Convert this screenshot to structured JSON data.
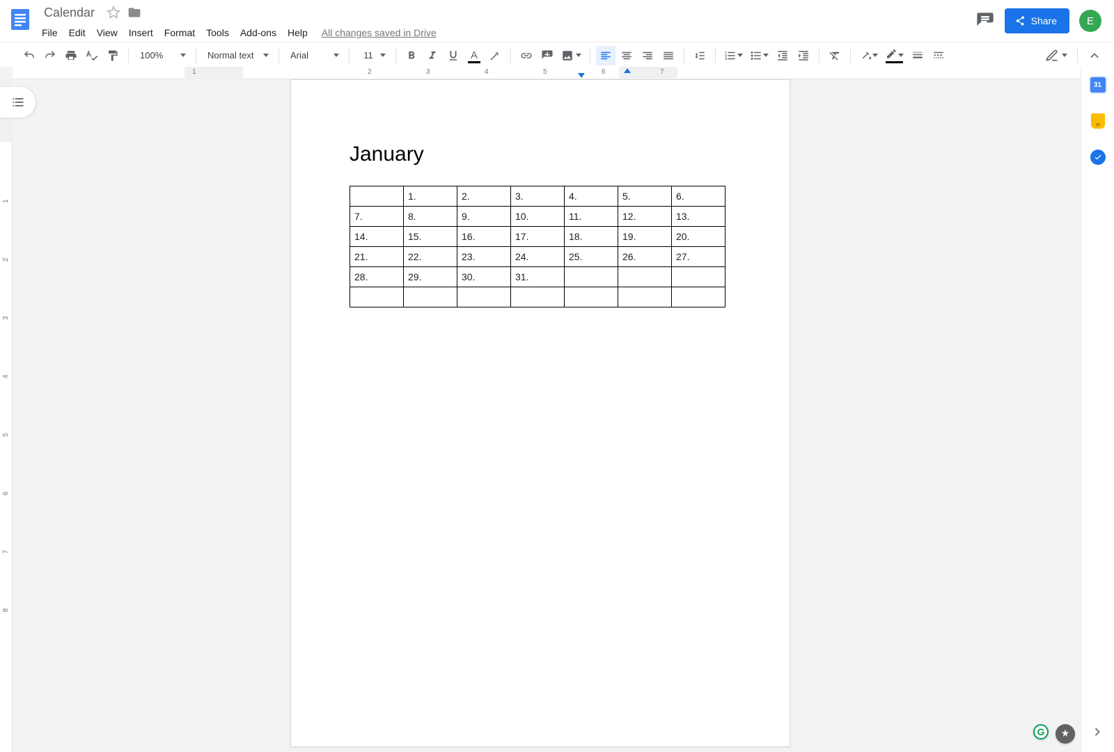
{
  "doc": {
    "title": "Calendar"
  },
  "menus": [
    "File",
    "Edit",
    "View",
    "Insert",
    "Format",
    "Tools",
    "Add-ons",
    "Help"
  ],
  "save_status": "All changes saved in Drive",
  "share_label": "Share",
  "avatar_initial": "E",
  "toolbar": {
    "zoom": "100%",
    "style": "Normal text",
    "font": "Arial",
    "size": "11"
  },
  "ruler": {
    "h_labels": [
      "1",
      "2",
      "3",
      "4",
      "5",
      "6",
      "7"
    ],
    "v_labels": [
      "1",
      "2",
      "3",
      "4",
      "5",
      "6",
      "7",
      "8"
    ]
  },
  "side_calendar_day": "31",
  "content": {
    "heading": "January",
    "rows": [
      [
        "",
        "1.",
        "2.",
        "3.",
        "4.",
        "5.",
        "6."
      ],
      [
        "7.",
        "8.",
        "9.",
        "10.",
        "11.",
        "12.",
        "13."
      ],
      [
        "14.",
        "15.",
        "16.",
        "17.",
        "18.",
        "19.",
        "20."
      ],
      [
        "21.",
        "22.",
        "23.",
        "24.",
        "25.",
        "26.",
        "27."
      ],
      [
        "28.",
        "29.",
        "30.",
        "31.",
        "",
        "",
        ""
      ],
      [
        "",
        "",
        "",
        "",
        "",
        "",
        ""
      ]
    ]
  }
}
